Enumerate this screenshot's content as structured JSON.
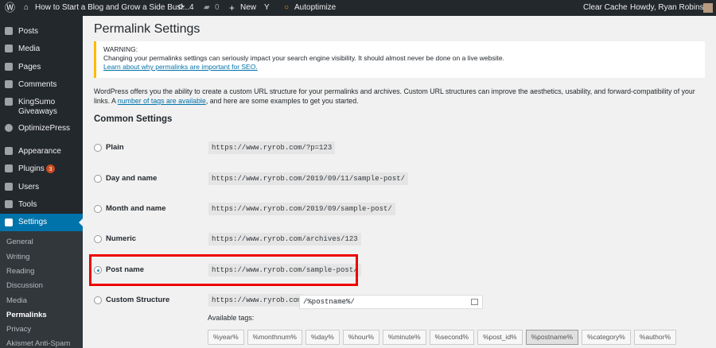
{
  "admin_bar": {
    "site_title": "How to Start a Blog and Grow a Side Busi...",
    "updates": "4",
    "comments": "0",
    "new_label": "New",
    "autoptimize": "Autoptimize",
    "clear_cache": "Clear Cache",
    "howdy": "Howdy, Ryan Robinson"
  },
  "sidebar": {
    "items": [
      {
        "label": "Posts"
      },
      {
        "label": "Media"
      },
      {
        "label": "Pages"
      },
      {
        "label": "Comments"
      },
      {
        "label": "KingSumo Giveaways"
      },
      {
        "label": "OptimizePress"
      },
      {
        "label": "Appearance"
      },
      {
        "label": "Plugins",
        "badge": "3"
      },
      {
        "label": "Users"
      },
      {
        "label": "Tools"
      },
      {
        "label": "Settings"
      }
    ],
    "submenu": [
      "General",
      "Writing",
      "Reading",
      "Discussion",
      "Media",
      "Permalinks",
      "Privacy",
      "Akismet Anti-Spam"
    ]
  },
  "page": {
    "title": "Permalink Settings",
    "warning": {
      "heading": "WARNING:",
      "text": "Changing your permalinks settings can seriously impact your search engine visibility. It should almost never be done on a live website.",
      "link": "Learn about why permalinks are important for SEO."
    },
    "intro_before": "WordPress offers you the ability to create a custom URL structure for your permalinks and archives. Custom URL structures can improve the aesthetics, usability, and forward-compatibility of your links. A ",
    "intro_link": "number of tags are available",
    "intro_after": ", and here are some examples to get you started.",
    "section": "Common Settings",
    "options": [
      {
        "label": "Plain",
        "example": "https://www.ryrob.com/?p=123"
      },
      {
        "label": "Day and name",
        "example": "https://www.ryrob.com/2019/09/11/sample-post/"
      },
      {
        "label": "Month and name",
        "example": "https://www.ryrob.com/2019/09/sample-post/"
      },
      {
        "label": "Numeric",
        "example": "https://www.ryrob.com/archives/123"
      },
      {
        "label": "Post name",
        "example": "https://www.ryrob.com/sample-post/"
      },
      {
        "label": "Custom Structure",
        "example": "https://www.ryrob.com"
      }
    ],
    "selected": "Post name",
    "custom_value": "/%postname%/",
    "available_tags_label": "Available tags:",
    "tags": [
      "%year%",
      "%monthnum%",
      "%day%",
      "%hour%",
      "%minute%",
      "%second%",
      "%post_id%",
      "%postname%",
      "%category%",
      "%author%"
    ]
  },
  "colors": {
    "adminbar": "#23282d",
    "accent": "#0073aa",
    "highlight": "#ee0000"
  }
}
